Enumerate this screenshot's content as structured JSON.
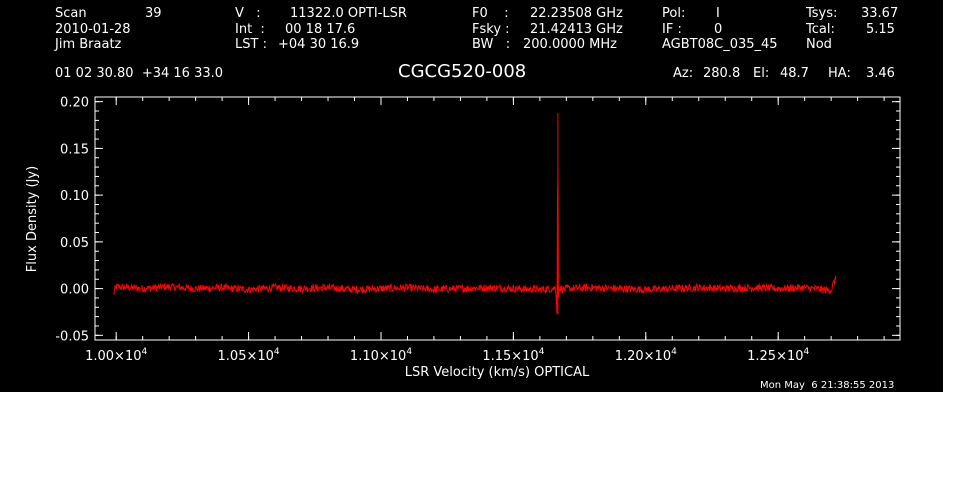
{
  "header": {
    "scan_label": "Scan",
    "scan_value": "39",
    "date": "2010-01-28",
    "observer": "Jim Braatz",
    "v_label": "V   :",
    "v_value": "11322.0 OPTI-LSR",
    "int_label": "Int  :",
    "int_value": "00 18 17.6",
    "lst_label": "LST :",
    "lst_value": "+04 30 16.9",
    "f0_label": "F0    :",
    "f0_value": "22.23508 GHz",
    "fsky_label": "Fsky :",
    "fsky_value": "21.42413 GHz",
    "bw_label": "BW   :",
    "bw_value": "200.0000 MHz",
    "pol_label": "Pol:",
    "pol_value": "I",
    "if_label": "IF :",
    "if_value": "0",
    "project": "AGBT08C_035_45",
    "tsys_label": "Tsys:",
    "tsys_value": "33.67",
    "tcal_label": "Tcal:",
    "tcal_value": "5.15",
    "mode": "Nod",
    "coords": "01 02 30.80  +34 16 33.0",
    "az_label": "Az:",
    "az_value": "280.8",
    "el_label": "El:",
    "el_value": "48.7",
    "ha_label": "HA:",
    "ha_value": "3.46"
  },
  "timestamp": "Mon May  6 21:38:55 2013",
  "chart_data": {
    "type": "line",
    "title": "CGCG520-008",
    "xlabel": "LSR Velocity (km/s) OPTICAL",
    "ylabel": "Flux Density (Jy)",
    "xlim": [
      9920,
      12960
    ],
    "ylim": [
      -0.055,
      0.205
    ],
    "x_ticks": [
      10000,
      10500,
      11000,
      11500,
      12000,
      12500
    ],
    "x_tick_mantissa": [
      "1.00×10",
      "1.05×10",
      "1.10×10",
      "1.15×10",
      "1.20×10",
      "1.25×10"
    ],
    "x_tick_exponent": "4",
    "y_ticks": [
      -0.05,
      0.0,
      0.05,
      0.1,
      0.15,
      0.2
    ],
    "y_tick_labels": [
      "-0.05",
      "0.00",
      "0.05",
      "0.10",
      "0.15",
      "0.20"
    ],
    "series": [
      {
        "color": "#ff0000",
        "x": [
          9990,
          10000,
          10050,
          10100,
          10200,
          10300,
          10400,
          10500,
          10600,
          10700,
          10800,
          10900,
          11000,
          11100,
          11200,
          11300,
          11400,
          11500,
          11600,
          11650,
          11660,
          11665,
          11668,
          11670,
          11675,
          11680,
          11690,
          11700,
          11800,
          11900,
          12000,
          12100,
          12200,
          12300,
          12400,
          12500,
          12600,
          12700,
          12710,
          12720
        ],
        "y": [
          -0.006,
          0.002,
          0.001,
          0.0,
          0.002,
          0.0,
          0.001,
          -0.001,
          0.001,
          0.0,
          0.001,
          -0.001,
          0.0,
          0.001,
          -0.001,
          0.0,
          0.001,
          0.0,
          -0.001,
          0.0,
          0.001,
          -0.028,
          0.188,
          -0.01,
          0.002,
          0.0,
          -0.001,
          0.0,
          0.001,
          0.0,
          -0.001,
          0.0,
          0.001,
          0.0,
          0.001,
          0.0,
          0.001,
          -0.002,
          0.006,
          0.012
        ]
      }
    ]
  }
}
